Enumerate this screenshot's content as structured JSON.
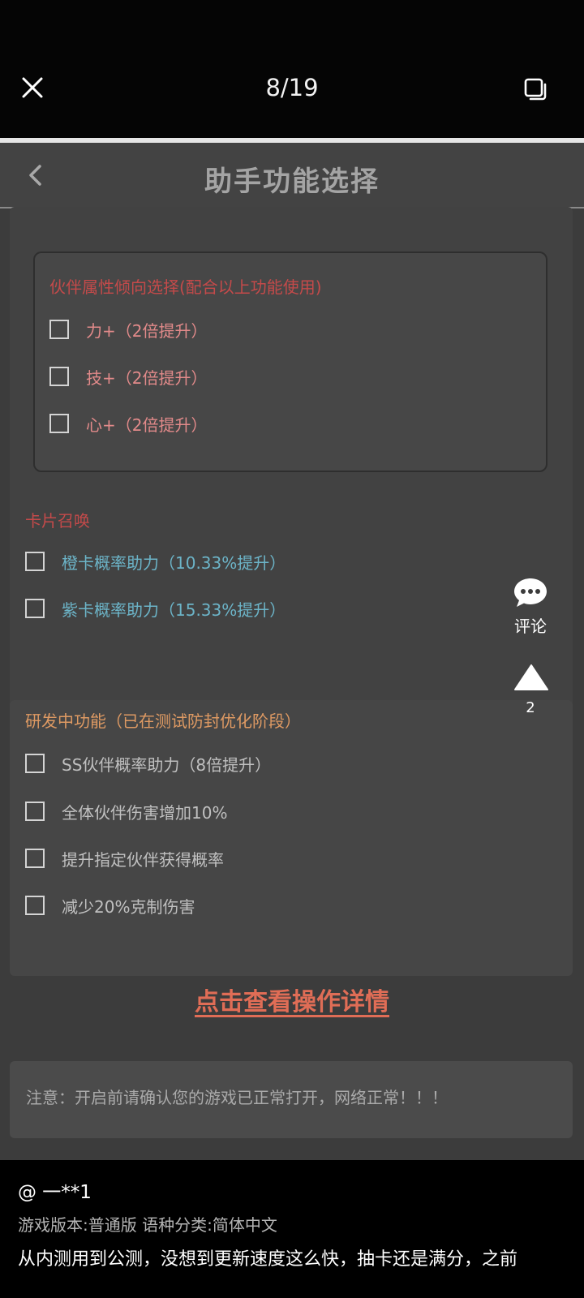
{
  "viewer": {
    "counter": "8/19"
  },
  "app": {
    "title": "助手功能选择"
  },
  "partner_section": {
    "heading": "伙伴属性倾向选择(配合以上功能使用)",
    "options": [
      {
        "label": "力+（2倍提升）"
      },
      {
        "label": "技+（2倍提升）"
      },
      {
        "label": "心+（2倍提升）"
      }
    ]
  },
  "card_section": {
    "heading": "卡片召唤",
    "options": [
      {
        "label": "橙卡概率助力（10.33%提升）"
      },
      {
        "label": "紫卡概率助力（15.33%提升）"
      }
    ]
  },
  "dev_section": {
    "heading": "研发中功能（已在测试防封优化阶段）",
    "options": [
      {
        "label": "SS伙伴概率助力（8倍提升）"
      },
      {
        "label": "全体伙伴伤害增加10%"
      },
      {
        "label": "提升指定伙伴获得概率"
      },
      {
        "label": "减少20%克制伤害"
      }
    ]
  },
  "detail_link": "点击查看操作详情",
  "notice": "注意：开启前请确认您的游戏已正常打开，网络正常！！！",
  "side_actions": {
    "comment_label": "评论",
    "upvote_count": "2"
  },
  "caption": {
    "author": "@ 一**1",
    "meta": "游戏版本:普通版 语种分类:简体中文",
    "text": "从内测用到公测，没想到更新速度这么快，抽卡还是满分，之前"
  },
  "colors": {
    "section_red": "#c44a4a",
    "option_pink": "#e28a8a",
    "option_cyan": "#6cb4c8",
    "dev_orange": "#df9a63",
    "link_red": "#e06d56"
  }
}
